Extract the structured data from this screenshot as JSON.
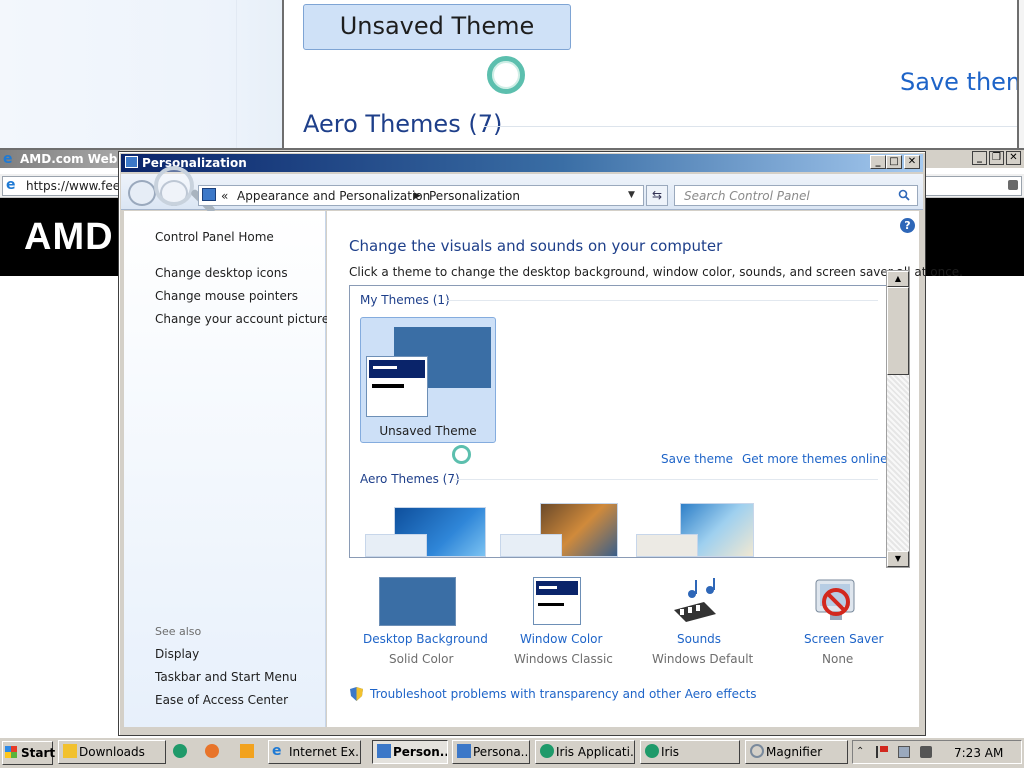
{
  "magnifier": {
    "theme_label": "Unsaved Theme",
    "save_theme": "Save theme",
    "aero_themes": "Aero Themes (7)"
  },
  "browser": {
    "title": "AMD.com Website",
    "address": "https://www.feed",
    "logo": "AMD"
  },
  "window": {
    "title": "Personalization",
    "breadcrumb": [
      "«",
      "Appearance and Personalization",
      "Personalization"
    ],
    "search_placeholder": "Search Control Panel",
    "controls": {
      "minimize": "_",
      "maximize": "□",
      "close": "✕"
    }
  },
  "left_pane": {
    "links": [
      "Control Panel Home",
      "Change desktop icons",
      "Change mouse pointers",
      "Change your account picture"
    ],
    "see_also_label": "See also",
    "see_also_links": [
      "Display",
      "Taskbar and Start Menu",
      "Ease of Access Center"
    ]
  },
  "main": {
    "title": "Change the visuals and sounds on your computer",
    "description": "Click a theme to change the desktop background, window color, sounds, and screen saver all at once.",
    "my_themes_label": "My Themes (1)",
    "current_theme": "Unsaved Theme",
    "save_theme": "Save theme",
    "get_more_themes": "Get more themes online",
    "aero_themes_label": "Aero Themes (7)",
    "help": "?"
  },
  "options": [
    {
      "label": "Desktop Background",
      "value": "Solid Color"
    },
    {
      "label": "Window Color",
      "value": "Windows Classic"
    },
    {
      "label": "Sounds",
      "value": "Windows Default"
    },
    {
      "label": "Screen Saver",
      "value": "None"
    }
  ],
  "troubleshoot": "Troubleshoot problems with transparency and other Aero effects",
  "taskbar": {
    "start": "Start",
    "buttons": [
      "Downloads",
      "Internet Ex...",
      "Person...",
      "Persona...",
      "Iris Applicati...",
      "Iris",
      "Magnifier"
    ],
    "clock": "7:23 AM",
    "clock_partial": "7:23 AM"
  },
  "colors": {
    "title_gradient_start": "#0a246a",
    "link_blue": "#1e64c8",
    "heading_blue": "#1e3f8a",
    "solid_background": "#3a6ea5"
  }
}
